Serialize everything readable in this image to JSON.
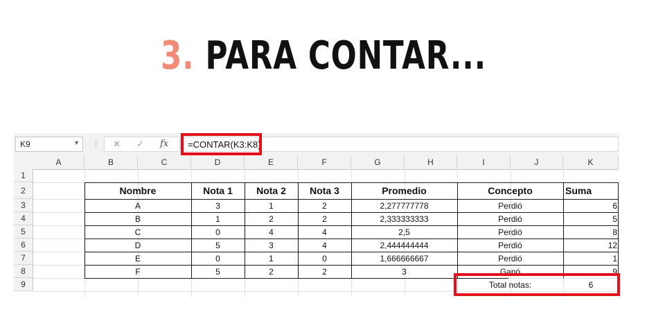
{
  "heading": {
    "number": "3.",
    "text": "PARA CONTAR..."
  },
  "formula_bar": {
    "name_box": "K9",
    "cancel_icon": "✕",
    "enter_icon": "✓",
    "fx_label": "fx",
    "formula": "=CONTAR(K3:K8)"
  },
  "columns": [
    "A",
    "B",
    "C",
    "D",
    "E",
    "F",
    "G",
    "H",
    "I",
    "J",
    "K"
  ],
  "rows": [
    "1",
    "2",
    "3",
    "4",
    "5",
    "6",
    "7",
    "8",
    "9"
  ],
  "table": {
    "headers": {
      "nombre": "Nombre",
      "nota1": "Nota 1",
      "nota2": "Nota 2",
      "nota3": "Nota 3",
      "promedio": "Promedio",
      "concepto": "Concepto",
      "suma": "Suma"
    },
    "rows": [
      {
        "nombre": "A",
        "nota1": "3",
        "nota2": "1",
        "nota3": "2",
        "promedio": "2,277777778",
        "concepto": "Perdió",
        "suma": "6"
      },
      {
        "nombre": "B",
        "nota1": "1",
        "nota2": "2",
        "nota3": "2",
        "promedio": "2,333333333",
        "concepto": "Perdió",
        "suma": "5"
      },
      {
        "nombre": "C",
        "nota1": "0",
        "nota2": "4",
        "nota3": "4",
        "promedio": "2,5",
        "concepto": "Perdió",
        "suma": "8"
      },
      {
        "nombre": "D",
        "nota1": "5",
        "nota2": "3",
        "nota3": "4",
        "promedio": "2,444444444",
        "concepto": "Perdió",
        "suma": "12"
      },
      {
        "nombre": "E",
        "nota1": "0",
        "nota2": "1",
        "nota3": "0",
        "promedio": "1,666666667",
        "concepto": "Perdió",
        "suma": "1"
      },
      {
        "nombre": "F",
        "nota1": "5",
        "nota2": "2",
        "nota3": "2",
        "promedio": "3",
        "concepto": "Ganó",
        "suma": "9"
      }
    ],
    "total_label": "Total notas:",
    "total_value": "6"
  },
  "colors": {
    "highlight": "#e5101b",
    "accent": "#f28b76"
  }
}
